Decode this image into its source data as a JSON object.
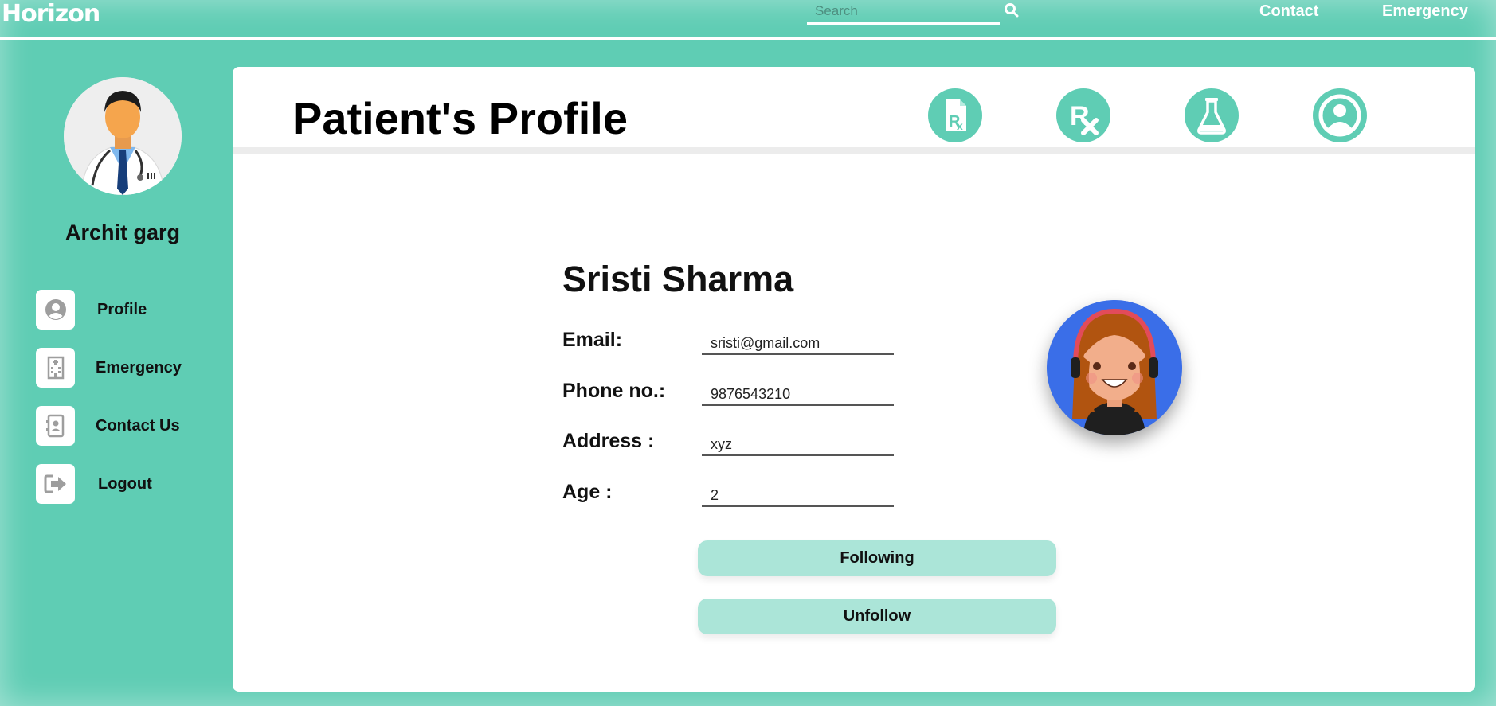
{
  "nav": {
    "brand": "Horizon",
    "search_placeholder": "Search",
    "links": [
      "Contact",
      "Emergency"
    ]
  },
  "sidebar": {
    "doctor_name": "Archit garg",
    "items": [
      {
        "label": "Profile",
        "icon": "user-circle-icon"
      },
      {
        "label": "Emergency",
        "icon": "hospital-icon"
      },
      {
        "label": "Contact Us",
        "icon": "contact-book-icon"
      },
      {
        "label": "Logout",
        "icon": "logout-icon"
      }
    ]
  },
  "main": {
    "title": "Patient's Profile",
    "header_icons": [
      "prescription-file-icon",
      "rx-icon",
      "lab-flask-icon",
      "user-circle-icon"
    ],
    "patient": {
      "name": "Sristi Sharma",
      "fields": [
        {
          "label": "Email:",
          "value": "sristi@gmail.com"
        },
        {
          "label": "Phone no.:",
          "value": "9876543210"
        },
        {
          "label": "Address :",
          "value": "xyz"
        },
        {
          "label": "Age :",
          "value": "2"
        }
      ]
    },
    "buttons": {
      "following": "Following",
      "unfollow": "Unfollow"
    }
  },
  "colors": {
    "accent": "#5fcdb4",
    "button": "#abe5d8",
    "avatar_bg": "#3a6ee8"
  }
}
